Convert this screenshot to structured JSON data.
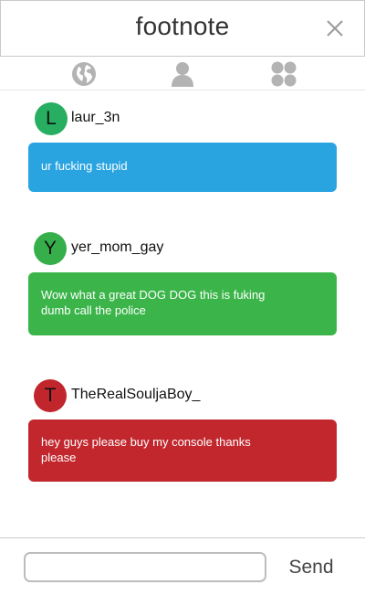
{
  "header": {
    "title": "footnote",
    "close_icon": "close-icon"
  },
  "nav": {
    "items": [
      {
        "icon": "globe-icon",
        "active": false
      },
      {
        "icon": "profile-icon",
        "active": false
      },
      {
        "icon": "apps-grid-icon",
        "active": false
      }
    ],
    "icon_color": "#b3b3b3"
  },
  "posts": [
    {
      "avatar_letter": "L",
      "avatar_color": "#27ae60",
      "username": "laur_3n",
      "message": "ur fucking stupid",
      "bubble_color": "#29a4e0"
    },
    {
      "avatar_letter": "Y",
      "avatar_color": "#36ae4a",
      "username": "yer_mom_gay",
      "message": "Wow what a great DOG DOG this is fuking dumb call the police",
      "bubble_color": "#3bb54a"
    },
    {
      "avatar_letter": "T",
      "avatar_color": "#c0262c",
      "username": "TheRealSouljaBoy_",
      "message": "hey guys please buy my console thanks please",
      "bubble_color": "#c1272d"
    }
  ],
  "compose": {
    "input_value": "",
    "placeholder": "",
    "send_label": "Send"
  }
}
